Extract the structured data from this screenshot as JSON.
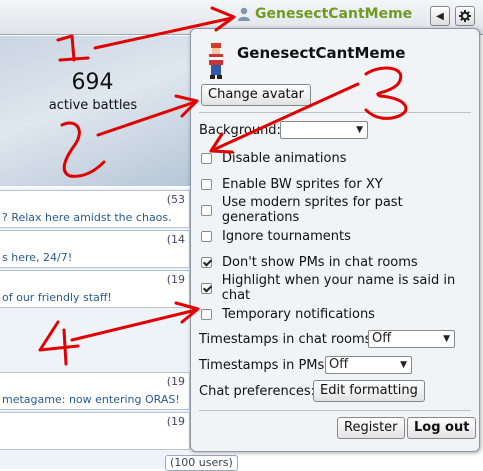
{
  "header": {
    "username": "GenesectCantMeme",
    "back_icon": "left-triangle-icon",
    "settings_icon": "gear-icon"
  },
  "lobby": {
    "battle_count": "694",
    "battle_label": "active battles"
  },
  "rooms": [
    {
      "count": "(53",
      "desc": "? Relax here amidst the chaos."
    },
    {
      "count": "(14",
      "desc": "s here, 24/7!"
    },
    {
      "count": "(19",
      "desc": "of our friendly staff!"
    },
    {
      "count": "(19",
      "desc": "metagame: now entering ORAS!"
    },
    {
      "count": "(19",
      "desc": ""
    }
  ],
  "users_pill": "(100 users)",
  "popup": {
    "name": "GenesectCantMeme",
    "change_avatar": "Change avatar",
    "background_label": "Background:",
    "background_value": "",
    "options": [
      {
        "label": "Disable animations",
        "checked": false
      },
      {
        "label": "Enable BW sprites for XY",
        "checked": false
      },
      {
        "label": "Use modern sprites for past generations",
        "checked": false
      },
      {
        "label": "Ignore tournaments",
        "checked": false
      },
      {
        "label": "Don't show PMs in chat rooms",
        "checked": true
      },
      {
        "label": "Highlight when your name is said in chat",
        "checked": true
      },
      {
        "label": "Temporary notifications",
        "checked": false
      }
    ],
    "timestamps_rooms_label": "Timestamps in chat rooms:",
    "timestamps_rooms_value": "Off",
    "timestamps_pms_label": "Timestamps in PMs:",
    "timestamps_pms_value": "Off",
    "chat_prefs_label": "Chat preferences:",
    "edit_formatting": "Edit formatting",
    "register": "Register",
    "logout": "Log out"
  },
  "annotations": {
    "color": "#e00000",
    "numbers": [
      "1",
      "2",
      "3",
      "4"
    ]
  }
}
